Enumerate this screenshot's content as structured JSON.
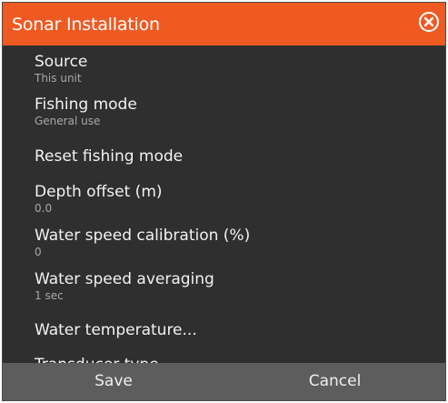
{
  "dialog": {
    "title": "Sonar Installation",
    "close_icon": "close-circle-icon"
  },
  "items": [
    {
      "label": "Source",
      "value": "This unit"
    },
    {
      "label": "Fishing mode",
      "value": "General use"
    },
    {
      "label": "Reset fishing mode"
    },
    {
      "label": "Depth offset (m)",
      "value": "0.0"
    },
    {
      "label": "Water speed calibration (%)",
      "value": "0"
    },
    {
      "label": "Water speed averaging",
      "value": "1 sec"
    },
    {
      "label": "Water temperature..."
    },
    {
      "label": "Transducer type"
    }
  ],
  "footer": {
    "save_label": "Save",
    "cancel_label": "Cancel"
  },
  "colors": {
    "title_bar": "#ef5a22",
    "background": "#2f2f2f",
    "footer": "#5d5d5d",
    "text": "#f2f2f2",
    "secondary_text": "#a8a8a8"
  }
}
